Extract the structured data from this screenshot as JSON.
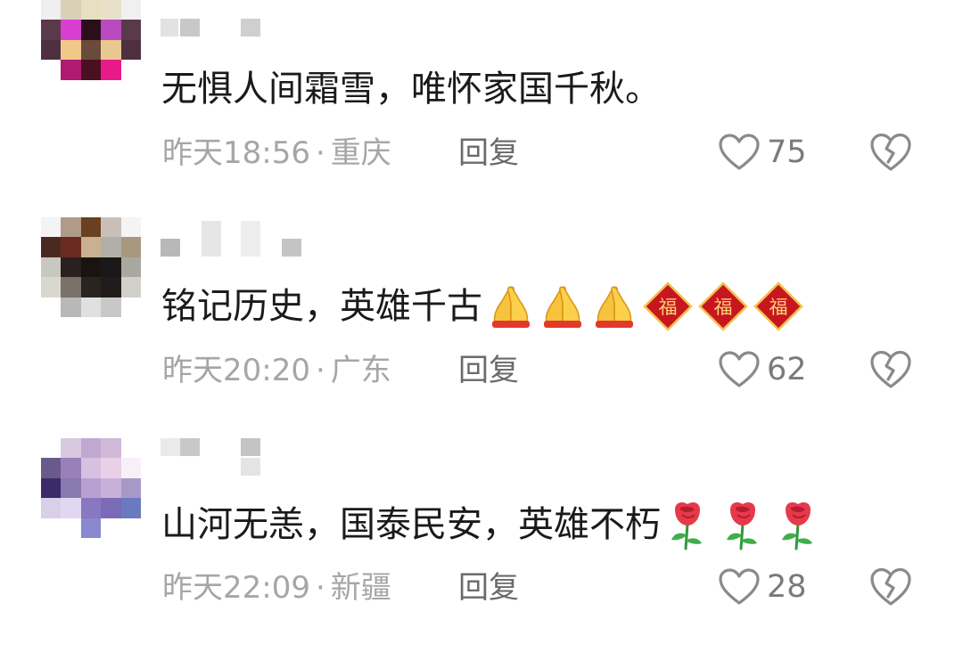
{
  "comments": [
    {
      "text": "无惧人间霜雪，唯怀家国千秋。",
      "time": "昨天18:56",
      "location": "重庆",
      "reply_label": "回复",
      "likes": "75",
      "emojis": []
    },
    {
      "text": "铭记历史，英雄千古",
      "time": "昨天20:20",
      "location": "广东",
      "reply_label": "回复",
      "likes": "62",
      "emojis": [
        "folded-hands",
        "folded-hands",
        "folded-hands",
        "fu-diamond",
        "fu-diamond",
        "fu-diamond"
      ],
      "fu_char": "福"
    },
    {
      "text": "山河无恙，国泰民安，英雄不朽",
      "time": "昨天22:09",
      "location": "新疆",
      "reply_label": "回复",
      "likes": "28",
      "emojis": [
        "rose",
        "rose",
        "rose"
      ]
    }
  ],
  "separator": "·",
  "colors": {
    "text": "#1a1a1a",
    "meta": "#a6a6a6",
    "reply": "#6a6a6a",
    "icon": "#8a8a8a"
  }
}
